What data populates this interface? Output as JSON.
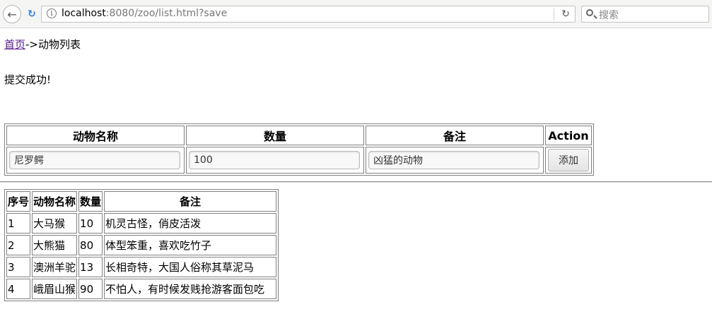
{
  "browser": {
    "url_host": "localhost",
    "url_rest": ":8080/zoo/list.html?save",
    "search_placeholder": "搜索"
  },
  "breadcrumb": {
    "home_link": "首页",
    "separator_current": "->动物列表"
  },
  "message": "提交成功!",
  "form": {
    "headers": [
      "动物名称",
      "数量",
      "备注",
      "Action"
    ],
    "name_value": "尼罗鳄",
    "count_value": "100",
    "remark_value": "凶猛的动物",
    "add_label": "添加"
  },
  "list": {
    "headers": [
      "序号",
      "动物名称",
      "数量",
      "备注"
    ],
    "rows": [
      {
        "no": "1",
        "name": "大马猴",
        "count": "10",
        "remark": "机灵古怪，俏皮活泼"
      },
      {
        "no": "2",
        "name": "大熊猫",
        "count": "80",
        "remark": "体型笨重，喜欢吃竹子"
      },
      {
        "no": "3",
        "name": "澳洲羊驼",
        "count": "13",
        "remark": "长相奇特，大国人俗称其草泥马"
      },
      {
        "no": "4",
        "name": "峨眉山猴",
        "count": "90",
        "remark": "不怕人，有时候发贱抢游客面包吃"
      }
    ]
  }
}
